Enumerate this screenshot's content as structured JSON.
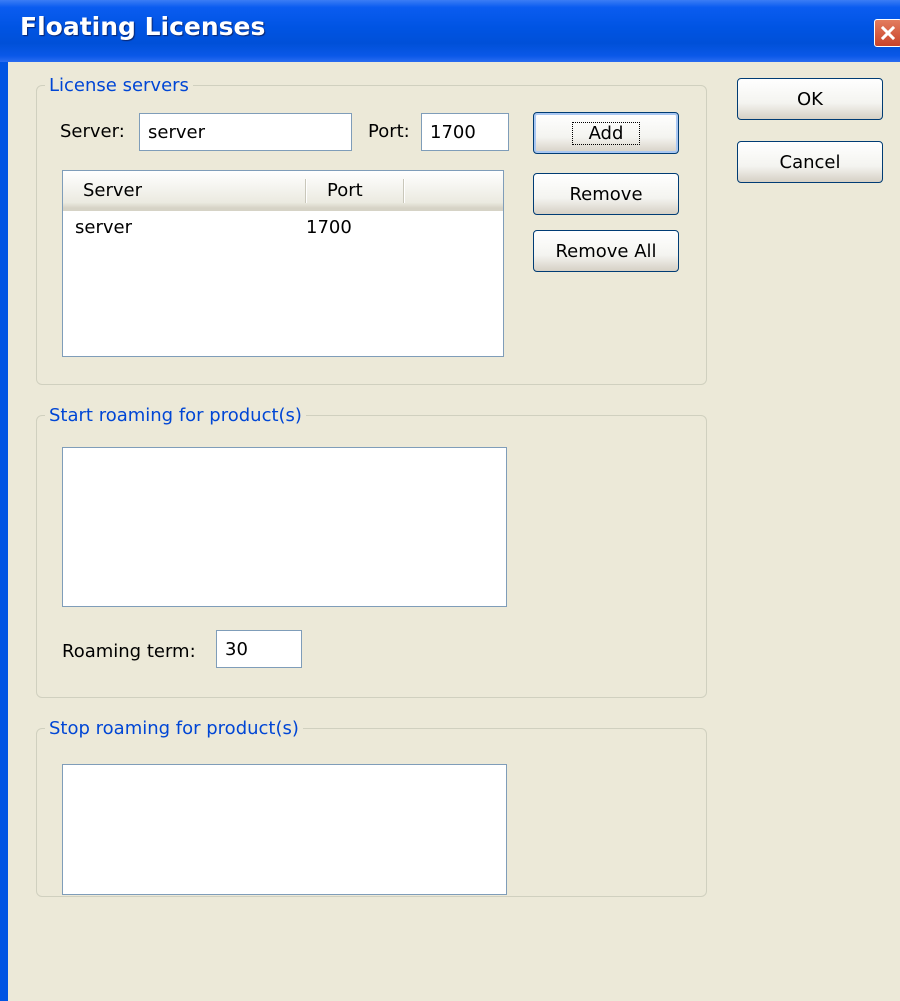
{
  "window": {
    "title": "Floating Licenses"
  },
  "license_servers": {
    "legend": "License servers",
    "server_label": "Server:",
    "server_value": "server",
    "port_label": "Port:",
    "port_value": "1700",
    "add_label": "Add",
    "remove_label": "Remove",
    "remove_all_label": "Remove All",
    "table": {
      "columns": [
        "Server",
        "Port"
      ],
      "rows": [
        {
          "server": "server",
          "port": "1700"
        }
      ]
    }
  },
  "start_roaming": {
    "legend": "Start roaming for product(s)",
    "term_label": "Roaming term:",
    "term_value": "30"
  },
  "stop_roaming": {
    "legend": "Stop roaming for product(s)"
  },
  "dialog_buttons": {
    "ok_label": "OK",
    "cancel_label": "Cancel"
  }
}
